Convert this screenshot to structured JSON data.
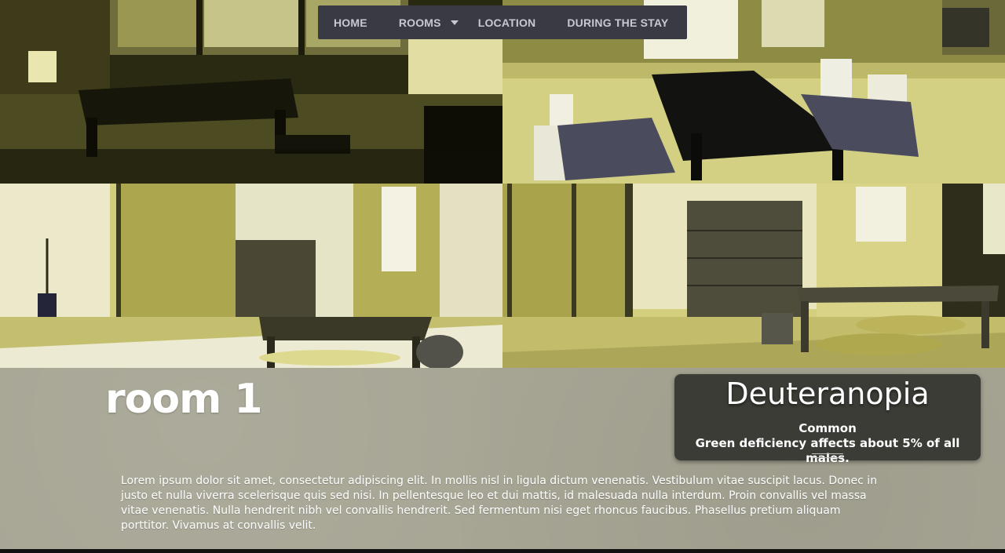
{
  "nav": {
    "items": [
      {
        "label": "HOME"
      },
      {
        "label": "ROOMS",
        "has_dropdown": true
      },
      {
        "label": "LOCATION"
      },
      {
        "label": "DURING THE STAY"
      }
    ]
  },
  "gallery": {
    "images": [
      {
        "subject": "dark tatami room with low table and cushion"
      },
      {
        "subject": "tatami room with black low table and chairs"
      },
      {
        "subject": "tatami room with chest of drawers and tea set"
      },
      {
        "subject": "tatami room with tansu chest and low table with cushions"
      }
    ]
  },
  "room": {
    "title": "room 1",
    "description": "Lorem ipsum dolor sit amet, consectetur adipiscing elit. In mollis nisl in ligula dictum venenatis. Vestibulum vitae suscipit lacus. Donec in justo et nulla viverra scelerisque quis sed nisi. In pellentesque leo et dui mattis, id malesuada nulla interdum. Proin convallis vel massa vitae venenatis. Nulla hendrerit nibh vel convallis hendrerit. Sed fermentum nisi eget rhoncus faucibus. Phasellus pretium aliquam porttitor. Vivamus at convallis velit."
  },
  "color_blindness": {
    "name": "Deuteranopia",
    "rarity": "Common",
    "description": "Green deficiency affects about 5% of all males."
  },
  "colors": {
    "nav_bg": "#3a3a45",
    "nav_text": "#c8c8d0",
    "content_bg": "#a7a594",
    "panel_bg": "#373732",
    "tint": "#c9c570"
  },
  "icons": {
    "dropdown": "chevron-down-icon"
  }
}
